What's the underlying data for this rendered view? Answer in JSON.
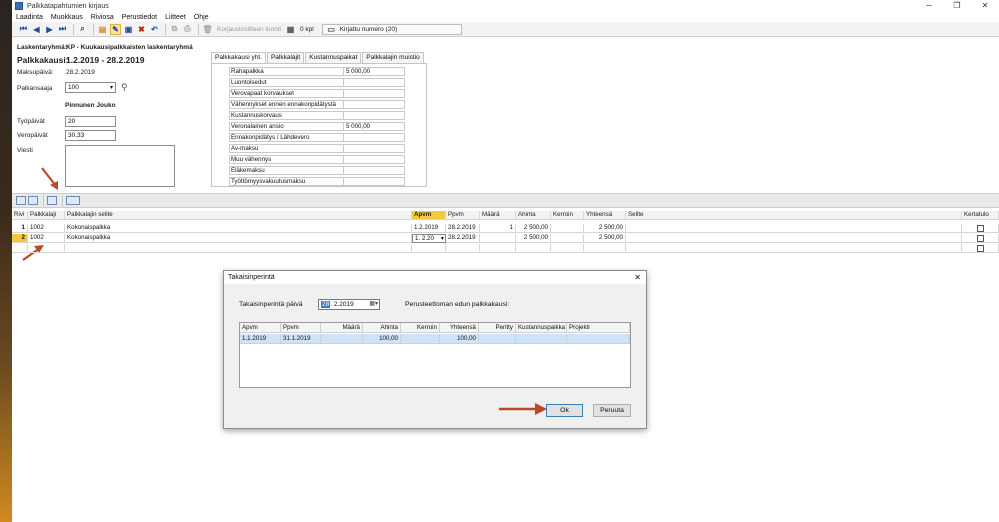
{
  "window": {
    "title": "Palkkatapahtumien kirjaus",
    "controls": [
      "─",
      "❐",
      "✕"
    ]
  },
  "menu": [
    "Laadinta",
    "Muokkaus",
    "Riviosa",
    "Perustiedot",
    "Liitteet",
    "Ohje"
  ],
  "toolbar": {
    "correction_label": "Korjaustositteen luonti",
    "count_label": "0 kpl",
    "booked_label": "Kirjattu numero (20)"
  },
  "form": {
    "group_label": "Laskentaryhmä:",
    "group_value": "KP - Kuukausipalkkaisten laskentaryhmä",
    "period_label": "Palkkakausi:",
    "period_value": "1.2.2019 - 28.2.2019",
    "payday_label": "Maksupäivä:",
    "payday_value": "28.2.2019",
    "payee_label": "Palkansaaja",
    "payee_value": "100",
    "payee_name": "Pinnunen Jouko",
    "workdays_label": "Työpäivät",
    "workdays_value": "20",
    "taxdays_label": "Veropäivät",
    "taxdays_value": "30,33",
    "message_label": "Viesti"
  },
  "tabs": [
    "Palkkakausi yht.",
    "Palkkalajit",
    "Kustannuspaikat",
    "Palkkalajin muistio"
  ],
  "summary": [
    {
      "label": "Rahapalkka",
      "value": "5 000,00"
    },
    {
      "label": "Luontoisedut",
      "value": ""
    },
    {
      "label": "Verovapaat korvaukset",
      "value": ""
    },
    {
      "label": "Vähennykset ennen ennakonpidätystä",
      "value": ""
    },
    {
      "label": "Kustannuskorvaus",
      "value": ""
    },
    {
      "label": "Veronalainen ansio",
      "value": "5 000,00"
    },
    {
      "label": "Ennakonpidätys / Lähdevero",
      "value": ""
    },
    {
      "label": "Av-maksu",
      "value": ""
    },
    {
      "label": "Muu vähennys",
      "value": ""
    },
    {
      "label": "Eläkemaksu",
      "value": ""
    },
    {
      "label": "Työttömyysvakuutusmaksu",
      "value": ""
    }
  ],
  "grid": {
    "headers": [
      "Rivi",
      "Palkkalaji",
      "Palkkalajin selite",
      "Apvm",
      "Ppvm",
      "Määrä",
      "Ahinta",
      "Kerroin",
      "Yhteensä",
      "Selite",
      "Kertatulo"
    ],
    "rows": [
      {
        "rivi": "1",
        "laji": "1002",
        "selite": "Kokonaispalkka",
        "apvm": "1.2.2019",
        "ppvm": "28.2.2019",
        "maara": "1",
        "ahinta": "2 500,00",
        "kerroin": "",
        "yhteensa": "2 500,00"
      },
      {
        "rivi": "2",
        "laji": "1002",
        "selite": "Kokonaispalkka",
        "apvm": "1. 2.20",
        "ppvm": "28.2.2019",
        "maara": "",
        "ahinta": "2 500,00",
        "kerroin": "",
        "yhteensa": "2 500,00"
      }
    ]
  },
  "dialog": {
    "title": "Takaisinperintä",
    "date_label": "Takaisinperintä päivä",
    "date_value_day": "28",
    "date_value_rest": ". 2.2019",
    "note_label": "Perusteettoman edun palkkakausi:",
    "headers": [
      "Apvm",
      "Ppvm",
      "Määrä",
      "Ahinta",
      "Kerroin",
      "Yhteensä",
      "Peritty",
      "Kustannuspaikka",
      "Projekti"
    ],
    "row": {
      "apvm": "1.1.2019",
      "ppvm": "31.1.2019",
      "maara": "",
      "ahinta": "100,00",
      "kerroin": "",
      "yhteensa": "100,00",
      "peritty": "",
      "kustannuspaikka": "",
      "projekti": ""
    },
    "ok_label": "Ok",
    "cancel_label": "Peruuta"
  },
  "colors": {
    "selected_header": "#f5c842",
    "dialog_row": "#cde3f9",
    "arrow": "#c0462a"
  }
}
